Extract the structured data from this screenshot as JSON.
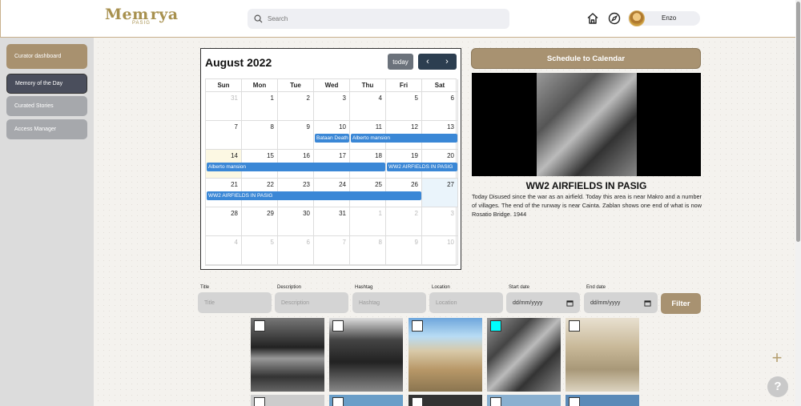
{
  "header": {
    "logo_text": "Memorya",
    "logo_sub": "PASIG",
    "search_placeholder": "Search",
    "user_name": "Enzo"
  },
  "sidebar": {
    "items": [
      {
        "label": "Curator dashboard"
      },
      {
        "label": "Memory of the Day"
      },
      {
        "label": "Curated Stories"
      },
      {
        "label": "Access Manager"
      }
    ]
  },
  "calendar": {
    "title": "August 2022",
    "today_label": "today",
    "prev_icon": "‹",
    "next_icon": "›",
    "weekdays": [
      "Sun",
      "Mon",
      "Tue",
      "Wed",
      "Thu",
      "Fri",
      "Sat"
    ],
    "days": [
      "31",
      "1",
      "2",
      "3",
      "4",
      "5",
      "6",
      "7",
      "8",
      "9",
      "10",
      "11",
      "12",
      "13",
      "14",
      "15",
      "16",
      "17",
      "18",
      "19",
      "20",
      "21",
      "22",
      "23",
      "24",
      "25",
      "26",
      "27",
      "28",
      "29",
      "30",
      "31",
      "1",
      "2",
      "3",
      "4",
      "5",
      "6",
      "7",
      "8",
      "9",
      "10"
    ],
    "events": [
      {
        "title": "Bataan Death"
      },
      {
        "title": "Alberto mansion"
      },
      {
        "title": "Alberto mansion"
      },
      {
        "title": "WW2 AIRFIELDS IN PASIG"
      },
      {
        "title": "WW2 AIRFIELDS IN PASIG"
      }
    ]
  },
  "story": {
    "schedule_label": "Schedule to Calendar",
    "title": "WW2 AIRFIELDS IN PASIG",
    "description": "Today Disused since the war as an airfield. Today this area is near Makro and a number of villages. The end of the runway is near Cainta. Zablan shows one end of what is now Rosatio Bridge. 1944"
  },
  "filters": {
    "title_label": "Title",
    "title_placeholder": "Title",
    "desc_label": "Description",
    "desc_placeholder": "Description",
    "hashtag_label": "Hashtag",
    "hashtag_placeholder": "Hashtag",
    "location_label": "Location",
    "location_placeholder": "Location",
    "start_label": "Start date",
    "start_value": "dd/mm/yyyy",
    "end_label": "End date",
    "end_value": "dd/mm/yyyy",
    "filter_label": "Filter"
  },
  "fab": {
    "add": "+",
    "help": "?"
  }
}
